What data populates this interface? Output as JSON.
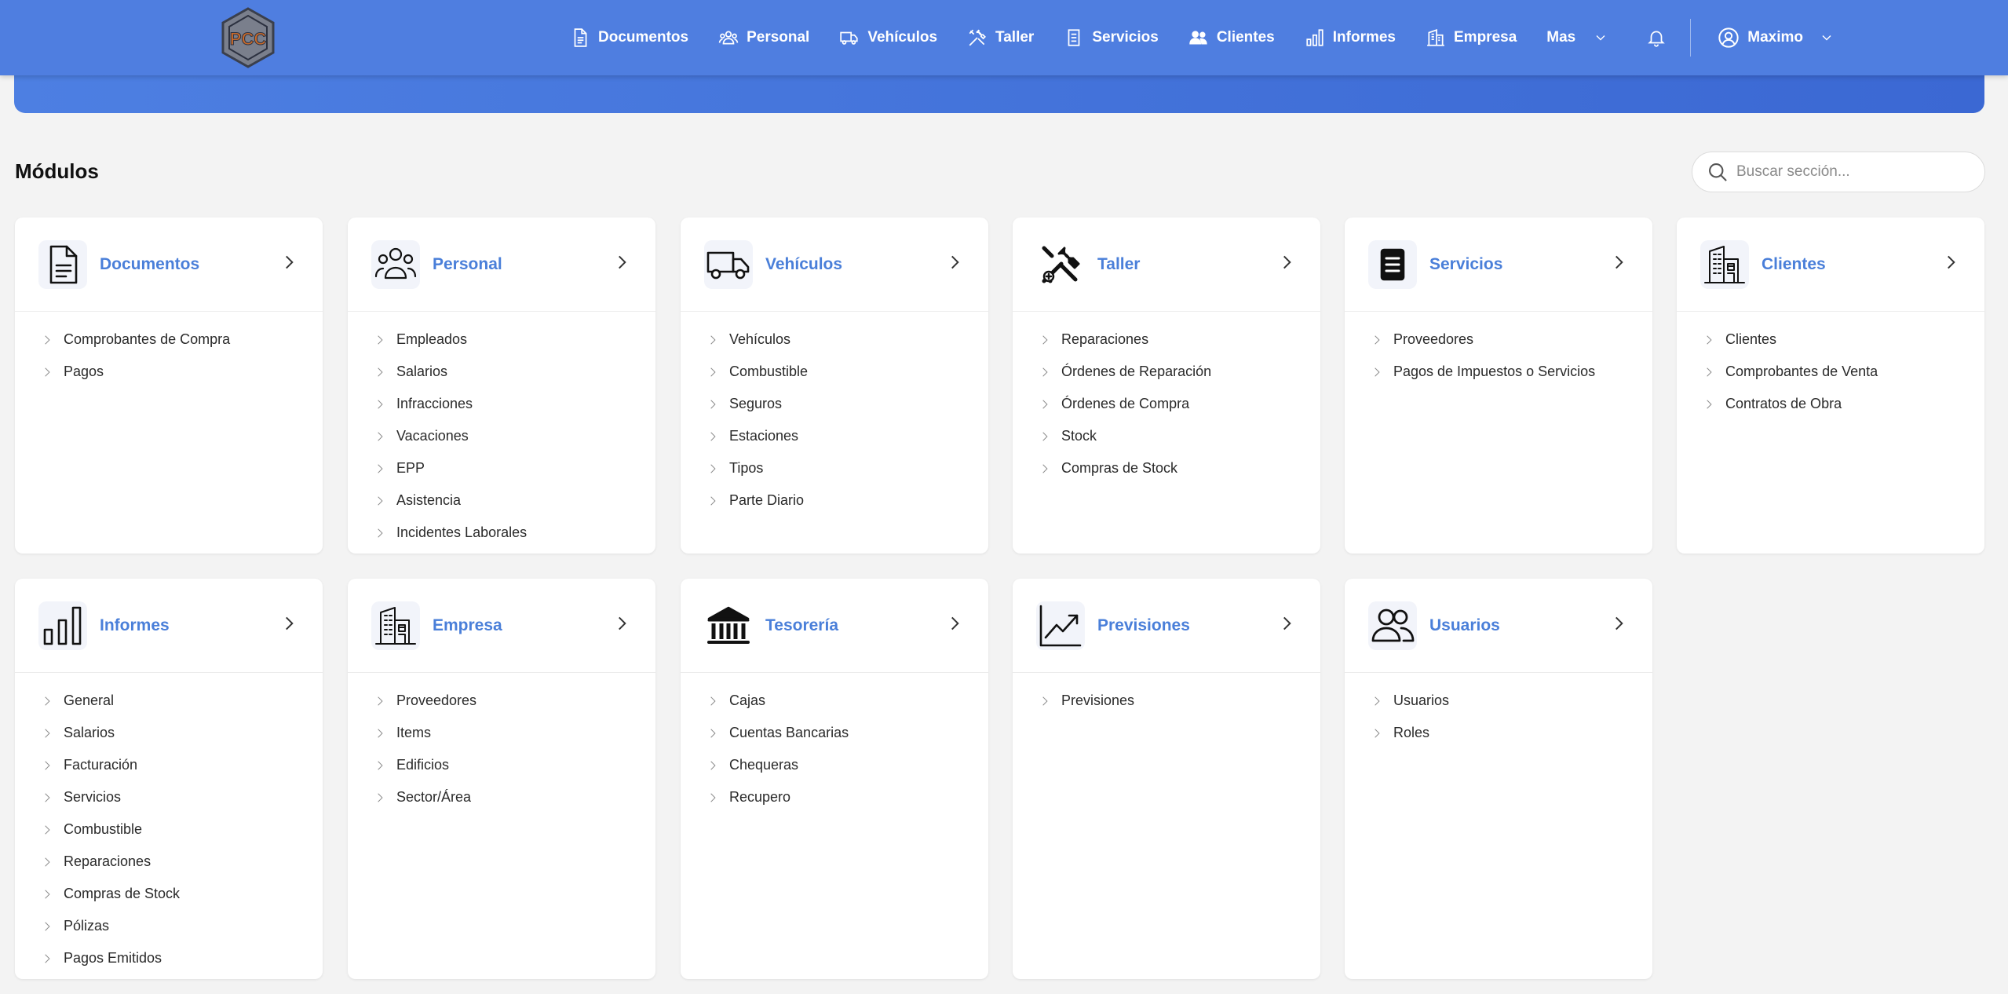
{
  "nav": {
    "logo_text": "PCC",
    "items": [
      {
        "label": "Documentos",
        "icon": "document-icon"
      },
      {
        "label": "Personal",
        "icon": "people-icon"
      },
      {
        "label": "Vehículos",
        "icon": "truck-icon"
      },
      {
        "label": "Taller",
        "icon": "tools-icon"
      },
      {
        "label": "Servicios",
        "icon": "service-icon"
      },
      {
        "label": "Clientes",
        "icon": "clients-icon"
      },
      {
        "label": "Informes",
        "icon": "chart-icon"
      },
      {
        "label": "Empresa",
        "icon": "building-icon"
      }
    ],
    "more_label": "Mas",
    "user_name": "Maximo"
  },
  "page": {
    "title": "Módulos",
    "search_placeholder": "Buscar sección..."
  },
  "modules": [
    {
      "title": "Documentos",
      "icon": "document-icon",
      "items": [
        "Comprobantes de Compra",
        "Pagos"
      ]
    },
    {
      "title": "Personal",
      "icon": "people-icon",
      "items": [
        "Empleados",
        "Salarios",
        "Infracciones",
        "Vacaciones",
        "EPP",
        "Asistencia",
        "Incidentes Laborales"
      ]
    },
    {
      "title": "Vehículos",
      "icon": "truck-icon",
      "items": [
        "Vehículos",
        "Combustible",
        "Seguros",
        "Estaciones",
        "Tipos",
        "Parte Diario"
      ]
    },
    {
      "title": "Taller",
      "icon": "tools-icon",
      "items": [
        "Reparaciones",
        "Órdenes de Reparación",
        "Órdenes de Compra",
        "Stock",
        "Compras de Stock"
      ]
    },
    {
      "title": "Servicios",
      "icon": "service-icon",
      "items": [
        "Proveedores",
        "Pagos de Impuestos o Servicios"
      ]
    },
    {
      "title": "Clientes",
      "icon": "building-icon",
      "items": [
        "Clientes",
        "Comprobantes de Venta",
        "Contratos de Obra"
      ]
    },
    {
      "title": "Informes",
      "icon": "chart-icon",
      "items": [
        "General",
        "Salarios",
        "Facturación",
        "Servicios",
        "Combustible",
        "Reparaciones",
        "Compras de Stock",
        "Pólizas",
        "Pagos Emitidos"
      ]
    },
    {
      "title": "Empresa",
      "icon": "building-icon",
      "items": [
        "Proveedores",
        "Items",
        "Edificios",
        "Sector/Área"
      ]
    },
    {
      "title": "Tesorería",
      "icon": "bank-icon",
      "items": [
        "Cajas",
        "Cuentas Bancarias",
        "Chequeras",
        "Recupero"
      ]
    },
    {
      "title": "Previsiones",
      "icon": "trend-icon",
      "items": [
        "Previsiones"
      ]
    },
    {
      "title": "Usuarios",
      "icon": "users-icon",
      "items": [
        "Usuarios",
        "Roles"
      ]
    }
  ]
}
